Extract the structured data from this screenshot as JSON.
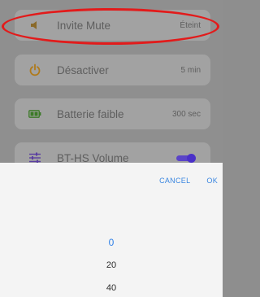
{
  "settings": {
    "rows": [
      {
        "label": "Invite Mute",
        "value": "Éteint"
      },
      {
        "label": "Désactiver",
        "value": "5 min"
      },
      {
        "label": "Batterie faible",
        "value": "300 sec"
      },
      {
        "label": "BT-HS Volume",
        "value": ""
      }
    ],
    "volume_toggle_on": true
  },
  "sheet": {
    "cancel_label": "CANCEL",
    "ok_label": "OK",
    "options": [
      "0",
      "20",
      "40"
    ],
    "selected": "0"
  },
  "colors": {
    "accent_blue": "#2f80e8",
    "highlight_red": "#e21b1b",
    "toggle_purple": "#4a30c8"
  }
}
